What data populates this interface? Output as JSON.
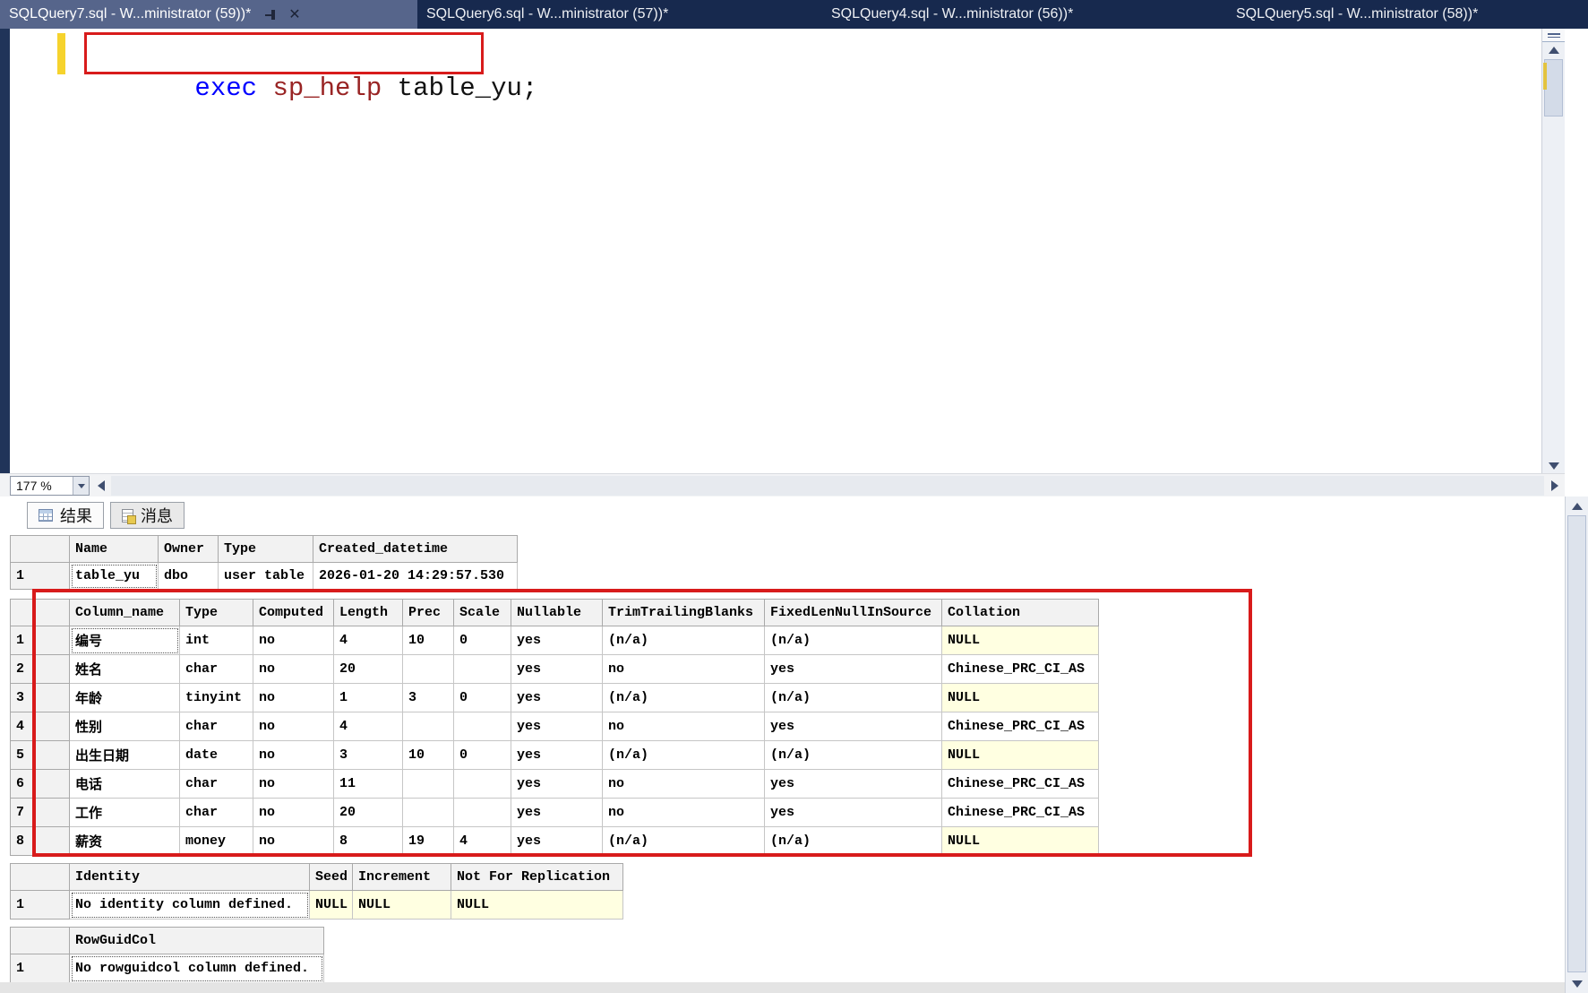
{
  "window": {
    "tabs": [
      {
        "label": "SQLQuery7.sql - W...ministrator (59))*",
        "active": true
      },
      {
        "label": "SQLQuery6.sql - W...ministrator (57))*",
        "active": false
      },
      {
        "label": "SQLQuery4.sql - W...ministrator (56))*",
        "active": false
      },
      {
        "label": "SQLQuery5.sql - W...ministrator (58))*",
        "active": false
      }
    ]
  },
  "editor": {
    "tokens": [
      {
        "text": "exec ",
        "color": "#0000ff"
      },
      {
        "text": "sp_help ",
        "color": "#992424"
      },
      {
        "text": "table_yu;",
        "color": "#111111"
      }
    ],
    "zoom_value": "177 %"
  },
  "results": {
    "tabs": [
      {
        "label": "结果"
      },
      {
        "label": "消息"
      }
    ],
    "grids": [
      {
        "headers": [
          "",
          "Name",
          "Owner",
          "Type",
          "Created_datetime"
        ],
        "rows": [
          [
            "1",
            "table_yu",
            "dbo",
            "user table",
            "2026-01-20 14:29:57.530"
          ]
        ],
        "focused_cell": {
          "row": 0,
          "col": 1
        }
      },
      {
        "headers": [
          "",
          "Column_name",
          "Type",
          "Computed",
          "Length",
          "Prec",
          "Scale",
          "Nullable",
          "TrimTrailingBlanks",
          "FixedLenNullInSource",
          "Collation"
        ],
        "rows": [
          [
            "1",
            "编号",
            "int",
            "no",
            "4",
            "10",
            "0",
            "yes",
            "(n/a)",
            "(n/a)",
            "NULL"
          ],
          [
            "2",
            "姓名",
            "char",
            "no",
            "20",
            "",
            "",
            "yes",
            "no",
            "yes",
            "Chinese_PRC_CI_AS"
          ],
          [
            "3",
            "年龄",
            "tinyint",
            "no",
            "1",
            "3",
            "0",
            "yes",
            "(n/a)",
            "(n/a)",
            "NULL"
          ],
          [
            "4",
            "性别",
            "char",
            "no",
            "4",
            "",
            "",
            "yes",
            "no",
            "yes",
            "Chinese_PRC_CI_AS"
          ],
          [
            "5",
            "出生日期",
            "date",
            "no",
            "3",
            "10",
            "0",
            "yes",
            "(n/a)",
            "(n/a)",
            "NULL"
          ],
          [
            "6",
            "电话",
            "char",
            "no",
            "11",
            "",
            "",
            "yes",
            "no",
            "yes",
            "Chinese_PRC_CI_AS"
          ],
          [
            "7",
            "工作",
            "char",
            "no",
            "20",
            "",
            "",
            "yes",
            "no",
            "yes",
            "Chinese_PRC_CI_AS"
          ],
          [
            "8",
            "薪资",
            "money",
            "no",
            "8",
            "19",
            "4",
            "yes",
            "(n/a)",
            "(n/a)",
            "NULL"
          ]
        ],
        "focused_cell": {
          "row": 0,
          "col": 1
        }
      },
      {
        "headers": [
          "",
          "Identity",
          "Seed",
          "Increment",
          "Not For Replication"
        ],
        "rows": [
          [
            "1",
            "No identity column defined.",
            "NULL",
            "NULL",
            "NULL"
          ]
        ],
        "focused_cell": {
          "row": 0,
          "col": 1
        }
      },
      {
        "headers": [
          "",
          "RowGuidCol"
        ],
        "rows": [
          [
            "1",
            "No rowguidcol column defined."
          ]
        ],
        "focused_cell": {
          "row": 0,
          "col": 1
        }
      }
    ]
  },
  "colors": {
    "tabbar_bg": "#17294e",
    "active_tab_bg": "#56658b",
    "keyword": "#0000ff",
    "system_proc": "#992424",
    "annotation_red": "#d81b1b",
    "null_cell_bg": "#ffffe1",
    "change_bar_yellow": "#f6d32d"
  }
}
